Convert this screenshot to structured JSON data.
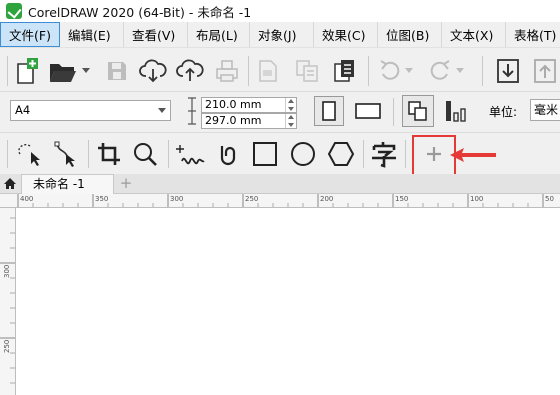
{
  "window": {
    "title": "CorelDRAW 2020 (64-Bit) - 未命名 -1"
  },
  "menu": [
    {
      "label": "文件(F)"
    },
    {
      "label": "编辑(E)"
    },
    {
      "label": "查看(V)"
    },
    {
      "label": "布局(L)"
    },
    {
      "label": "对象(J)"
    },
    {
      "label": "效果(C)"
    },
    {
      "label": "位图(B)"
    },
    {
      "label": "文本(X)"
    },
    {
      "label": "表格(T)"
    }
  ],
  "property_bar": {
    "page_size": "A4",
    "width": "210.0 mm",
    "height": "297.0 mm",
    "unit_label": "单位:",
    "unit_value": "毫米"
  },
  "tabs": {
    "document": "未命名 -1",
    "add_symbol": "+"
  },
  "ruler": {
    "h_labels": [
      "400",
      "350",
      "300",
      "250",
      "200",
      "150",
      "100",
      "50"
    ],
    "v_labels": [
      "300",
      "250"
    ]
  },
  "colors": {
    "highlight": "#e53935",
    "active_menu": "#cce4f7"
  },
  "icons": [
    "new-document-icon",
    "open-folder-icon",
    "save-icon",
    "cloud-download-icon",
    "cloud-upload-icon",
    "print-icon",
    "import-icon",
    "export-icon",
    "publish-pdf-icon",
    "undo-icon",
    "redo-icon",
    "import-arrow-icon",
    "export-arrow-icon",
    "portrait-icon",
    "landscape-icon",
    "all-pages-icon",
    "current-page-icon",
    "freehand-pick-icon",
    "shape-tool-icon",
    "crop-icon",
    "zoom-icon",
    "freehand-icon",
    "artistic-media-icon",
    "rectangle-icon",
    "ellipse-icon",
    "polygon-icon",
    "text-icon",
    "add-tool-icon",
    "red-arrow-icon",
    "home-icon"
  ]
}
